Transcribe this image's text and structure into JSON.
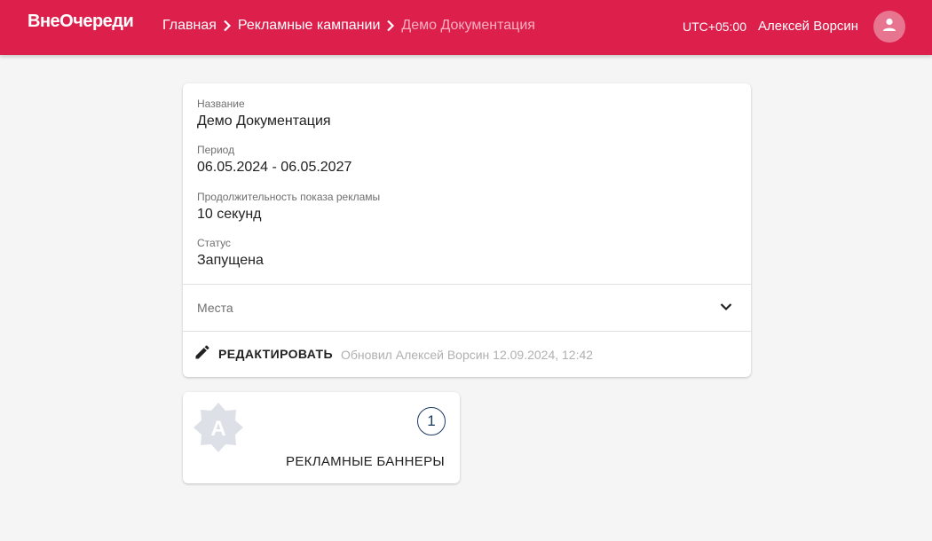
{
  "header": {
    "logo": "ВнеОчереди",
    "breadcrumbs": [
      {
        "label": "Главная"
      },
      {
        "label": "Рекламные кампании"
      },
      {
        "label": "Демо Документация"
      }
    ],
    "timezone": "UTC+05:00",
    "user_name": "Алексей Ворсин",
    "brand_color": "#dc1f4b"
  },
  "campaign": {
    "fields": [
      {
        "label": "Название",
        "value": "Демо Документация"
      },
      {
        "label": "Период",
        "value": "06.05.2024 - 06.05.2027"
      },
      {
        "label": "Продолжительность показа рекламы",
        "value": "10 секунд"
      },
      {
        "label": "Статус",
        "value": "Запущена"
      }
    ],
    "places_label": "Места",
    "edit_label": "РЕДАКТИРОВАТЬ",
    "updated_text": "Обновил Алексей Ворсин 12.09.2024, 12:42"
  },
  "banners_tile": {
    "icon_letter": "A",
    "count": "1",
    "title": "РЕКЛАМНЫЕ БАННЕРЫ"
  }
}
